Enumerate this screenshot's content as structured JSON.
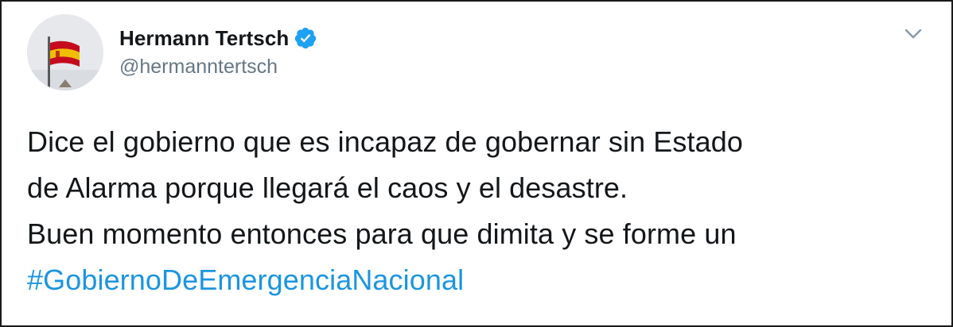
{
  "author": {
    "display_name": "Hermann Tertsch",
    "handle": "@hermanntertsch",
    "verified": true,
    "avatar_icon": "spanish-flag-avatar"
  },
  "menu": {
    "icon": "chevron-down-icon"
  },
  "tweet": {
    "lines": [
      "Dice el gobierno que es incapaz de gobernar sin Estado",
      "de Alarma porque llegará el caos y el desastre.",
      "Buen momento entonces para que dimita y se forme un"
    ],
    "hashtag": "#GobiernoDeEmergenciaNacional"
  },
  "colors": {
    "link": "#1b95e0",
    "verified_badge": "#1da1f2",
    "handle_text": "#657786",
    "body_text": "#14171a"
  }
}
